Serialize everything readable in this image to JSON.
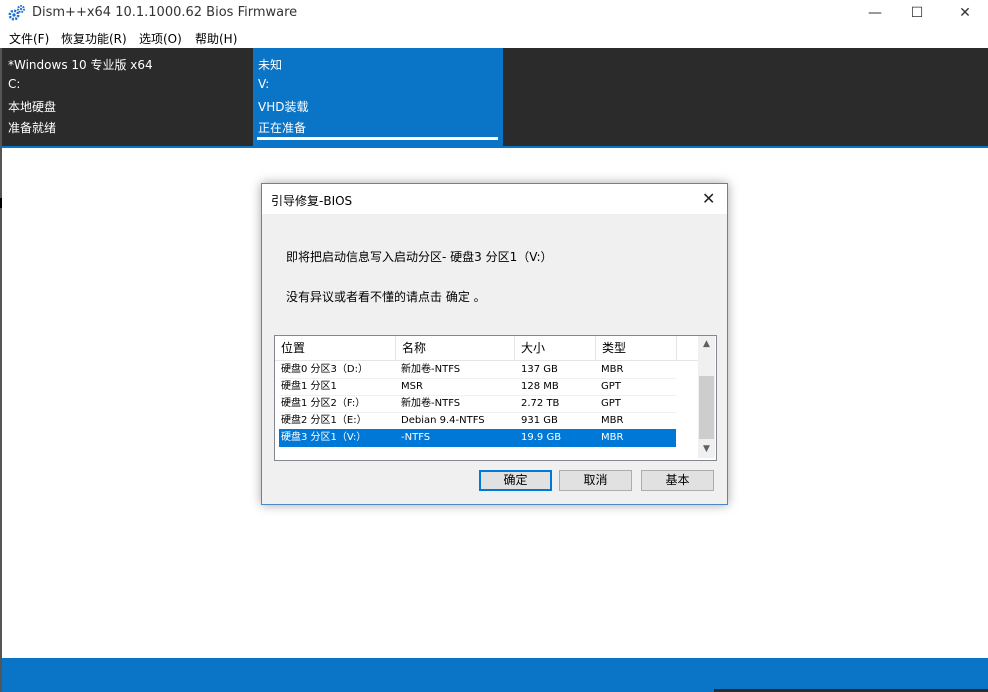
{
  "window": {
    "title": "Dism++x64 10.1.1000.62 Bios Firmware",
    "minimize_glyph": "—",
    "maximize_glyph": "☐",
    "close_glyph": "✕"
  },
  "menu": [
    {
      "label": "文件(F)"
    },
    {
      "label": "恢复功能(R)"
    },
    {
      "label": "选项(O)"
    },
    {
      "label": "帮助(H)"
    }
  ],
  "sessions": {
    "current": {
      "name": "*Windows 10 专业版 x64",
      "drive": "C:",
      "type": "本地硬盘",
      "status": "准备就绪"
    },
    "selected": {
      "name": "未知",
      "drive": "V:",
      "type": "VHD装载",
      "status": "正在准备"
    }
  },
  "dialog": {
    "title": "引导修复-BIOS",
    "close_glyph": "✕",
    "message1": "即将把启动信息写入启动分区- 硬盘3 分区1（V:）",
    "message2": "没有异议或者看不懂的请点击 确定 。",
    "columns": [
      "位置",
      "名称",
      "大小",
      "类型"
    ],
    "rows": [
      {
        "location": "硬盘0 分区3（D:）",
        "name": "新加卷-NTFS",
        "size": "137 GB",
        "type": "MBR"
      },
      {
        "location": "硬盘1 分区1",
        "name": "MSR",
        "size": "128 MB",
        "type": "GPT"
      },
      {
        "location": "硬盘1 分区2（F:）",
        "name": "新加卷-NTFS",
        "size": "2.72 TB",
        "type": "GPT"
      },
      {
        "location": "硬盘2 分区1（E:）",
        "name": "Debian 9.4-NTFS",
        "size": "931 GB",
        "type": "MBR"
      },
      {
        "location": "硬盘3 分区1（V:）",
        "name": "-NTFS",
        "size": "19.9 GB",
        "type": "MBR",
        "selected": true
      }
    ],
    "scroll_up_glyph": "▲",
    "scroll_down_glyph": "▼",
    "buttons": {
      "ok": "确定",
      "cancel": "取消",
      "basic": "基本"
    }
  },
  "colors": {
    "accent": "#0a74c6",
    "dark_panel": "#2b2b2b",
    "selection": "#0078d7"
  },
  "icons": {
    "app": "gear-icon"
  }
}
